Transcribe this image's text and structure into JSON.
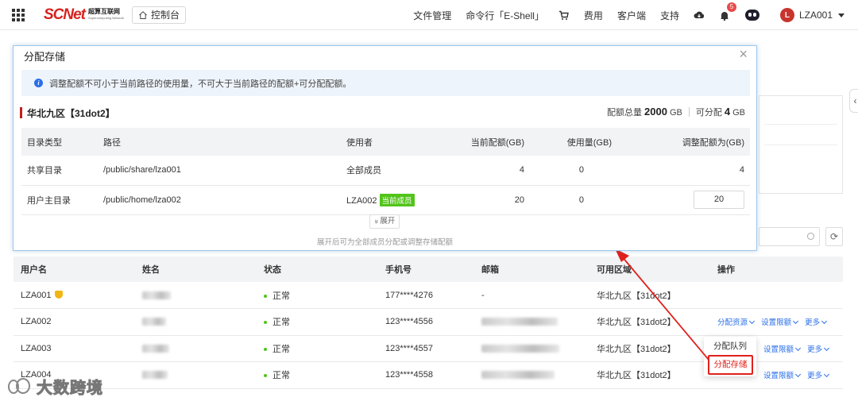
{
  "nav": {
    "logo_main": "SCNet",
    "logo_cn": "超算互联网",
    "logo_en": "Supercomputing Network",
    "console_label": "控制台",
    "links": [
      "文件管理",
      "命令行「E-Shell」"
    ],
    "billing": "费用",
    "client": "客户端",
    "support": "支持",
    "notification_count": "5",
    "user_initial": "L",
    "username": "LZA001"
  },
  "modal": {
    "title": "分配存储",
    "close": "×",
    "alert_text": "调整配额不可小于当前路径的使用量，不可大于当前路径的配额+可分配配额。",
    "region": "华北九区【31dot2】",
    "quota_total_label": "配额总量",
    "quota_total_value": "2000",
    "quota_unit": "GB",
    "available_label": "可分配",
    "available_value": "4",
    "columns": [
      "目录类型",
      "路径",
      "使用者",
      "当前配额(GB)",
      "使用量(GB)",
      "调整配额为(GB)"
    ],
    "rows": [
      {
        "type": "共享目录",
        "path": "/public/share/lza001",
        "user": "全部成员",
        "quota": "4",
        "used": "0",
        "adjust": "4"
      },
      {
        "type": "用户主目录",
        "path": "/public/home/lza002",
        "user": "LZA002",
        "tag": "当前成员",
        "quota": "20",
        "used": "0",
        "adjust": "20"
      }
    ],
    "expand_label": "展开",
    "expand_hint": "展开后可为全部成员分配或调整存储配额"
  },
  "user_table": {
    "columns": [
      "用户名",
      "姓名",
      "状态",
      "手机号",
      "邮箱",
      "可用区域",
      "操作"
    ],
    "rows": [
      {
        "username": "LZA001",
        "status": "正常",
        "phone": "177****4276",
        "email": "-",
        "region": "华北九区【31dot2】"
      },
      {
        "username": "LZA002",
        "status": "正常",
        "phone": "123****4556",
        "region": "华北九区【31dot2】"
      },
      {
        "username": "LZA003",
        "status": "正常",
        "phone": "123****4557",
        "region": "华北九区【31dot2】"
      },
      {
        "username": "LZA004",
        "status": "正常",
        "phone": "123****4558",
        "region": "华北九区【31dot2】"
      }
    ],
    "ops": {
      "assign_resource": "分配资源",
      "set_limit": "设置限额",
      "more": "更多"
    }
  },
  "dropdown": {
    "queue": "分配队列",
    "storage": "分配存储"
  },
  "watermark": "大数跨境",
  "colors": {
    "brand_red": "#d6231f",
    "link_blue": "#2a6fe8",
    "success_green": "#52c41a",
    "highlight_red": "#e0201c"
  }
}
